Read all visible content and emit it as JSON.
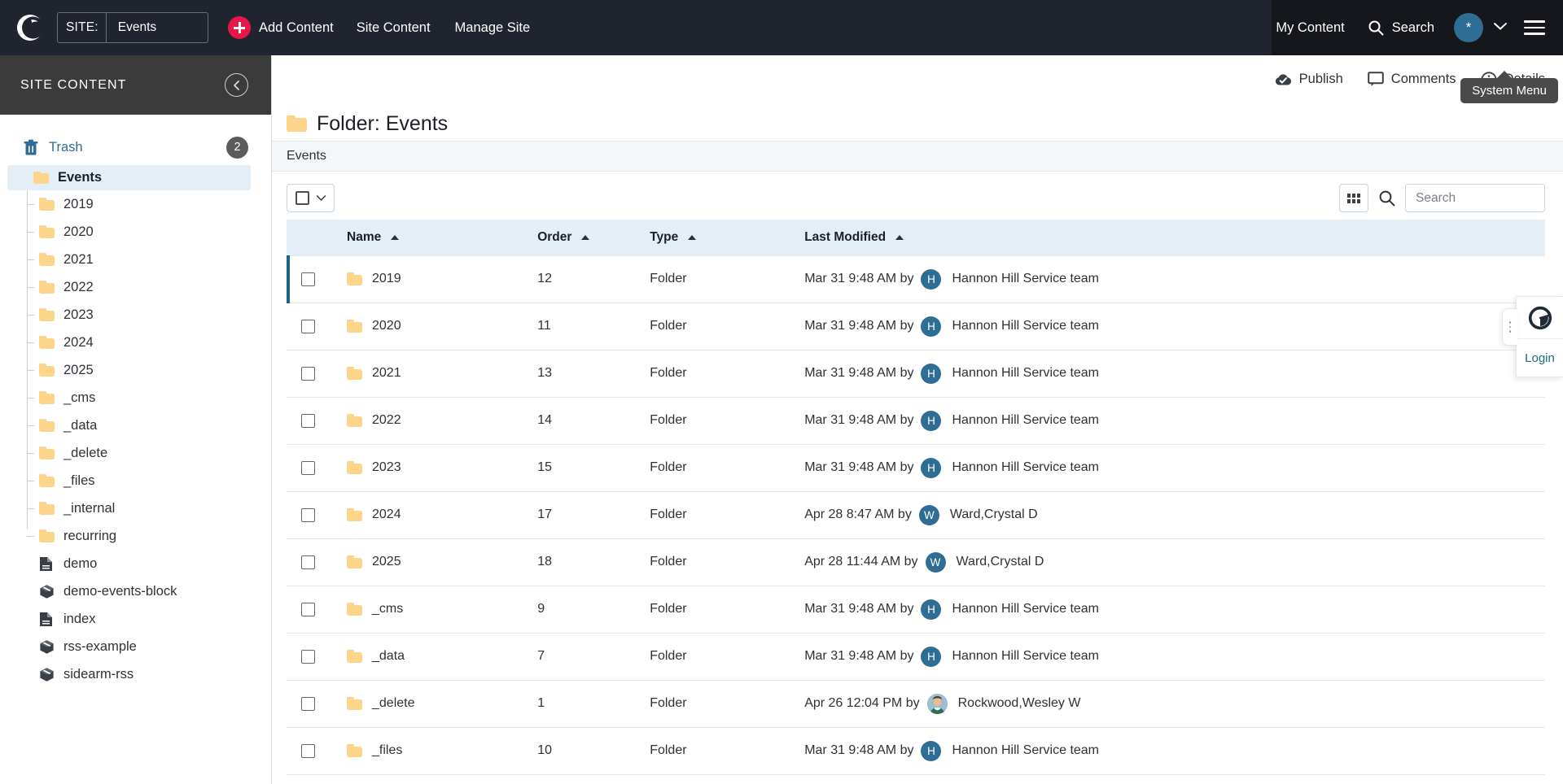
{
  "topbar": {
    "logo_icon": "cascade-logo-icon",
    "site_label": "SITE:",
    "site_value": "Events",
    "add_content": "Add Content",
    "nav": [
      {
        "label": "Site Content"
      },
      {
        "label": "Manage Site"
      }
    ],
    "my_content": "My Content",
    "search": "Search",
    "avatar_initial": "*"
  },
  "sidebar": {
    "header_title": "SITE CONTENT",
    "collapse_icon": "chevron-left-icon",
    "trash": {
      "label": "Trash",
      "count": "2",
      "icon": "trash-icon"
    },
    "root": {
      "label": "Events",
      "icon": "folder-icon"
    },
    "items": [
      {
        "label": "2019",
        "icon": "folder-icon"
      },
      {
        "label": "2020",
        "icon": "folder-icon"
      },
      {
        "label": "2021",
        "icon": "folder-icon"
      },
      {
        "label": "2022",
        "icon": "folder-icon"
      },
      {
        "label": "2023",
        "icon": "folder-icon"
      },
      {
        "label": "2024",
        "icon": "folder-icon"
      },
      {
        "label": "2025",
        "icon": "folder-icon"
      },
      {
        "label": "_cms",
        "icon": "folder-icon"
      },
      {
        "label": "_data",
        "icon": "folder-icon"
      },
      {
        "label": "_delete",
        "icon": "folder-icon"
      },
      {
        "label": "_files",
        "icon": "folder-icon"
      },
      {
        "label": "_internal",
        "icon": "folder-icon"
      },
      {
        "label": "recurring",
        "icon": "folder-icon"
      },
      {
        "label": "demo",
        "icon": "page-icon"
      },
      {
        "label": "demo-events-block",
        "icon": "block-icon"
      },
      {
        "label": "index",
        "icon": "page-icon"
      },
      {
        "label": "rss-example",
        "icon": "block-icon"
      },
      {
        "label": "sidearm-rss",
        "icon": "block-icon"
      }
    ]
  },
  "main": {
    "toolbar": [
      {
        "label": "Publish",
        "icon": "publish-cloud-check-icon"
      },
      {
        "label": "Comments",
        "icon": "comment-icon"
      },
      {
        "label": "Details",
        "icon": "info-circle-icon"
      }
    ],
    "tooltip": "System Menu",
    "page_title": "Folder: Events",
    "breadcrumb": "Events",
    "search_placeholder": "Search",
    "search_value": "",
    "grid_toggle_icon": "grid-view-icon",
    "search_icon": "search-icon",
    "columns": [
      {
        "label": "Name",
        "sort": "asc"
      },
      {
        "label": "Order",
        "sort": "asc"
      },
      {
        "label": "Type",
        "sort": "asc"
      },
      {
        "label": "Last Modified",
        "sort": "asc"
      }
    ],
    "rows": [
      {
        "name": "2019",
        "icon": "folder-icon",
        "order": "12",
        "type": "Folder",
        "modified": "Mar 31 9:48 AM by",
        "avatar": "H",
        "avatar_kind": "initial",
        "user": "Hannon Hill Service team"
      },
      {
        "name": "2020",
        "icon": "folder-icon",
        "order": "11",
        "type": "Folder",
        "modified": "Mar 31 9:48 AM by",
        "avatar": "H",
        "avatar_kind": "initial",
        "user": "Hannon Hill Service team"
      },
      {
        "name": "2021",
        "icon": "folder-icon",
        "order": "13",
        "type": "Folder",
        "modified": "Mar 31 9:48 AM by",
        "avatar": "H",
        "avatar_kind": "initial",
        "user": "Hannon Hill Service team"
      },
      {
        "name": "2022",
        "icon": "folder-icon",
        "order": "14",
        "type": "Folder",
        "modified": "Mar 31 9:48 AM by",
        "avatar": "H",
        "avatar_kind": "initial",
        "user": "Hannon Hill Service team"
      },
      {
        "name": "2023",
        "icon": "folder-icon",
        "order": "15",
        "type": "Folder",
        "modified": "Mar 31 9:48 AM by",
        "avatar": "H",
        "avatar_kind": "initial",
        "user": "Hannon Hill Service team"
      },
      {
        "name": "2024",
        "icon": "folder-icon",
        "order": "17",
        "type": "Folder",
        "modified": "Apr 28 8:47 AM by",
        "avatar": "W",
        "avatar_kind": "initial",
        "user": "Ward,Crystal D"
      },
      {
        "name": "2025",
        "icon": "folder-icon",
        "order": "18",
        "type": "Folder",
        "modified": "Apr 28 11:44 AM by",
        "avatar": "W",
        "avatar_kind": "initial",
        "user": "Ward,Crystal D"
      },
      {
        "name": "_cms",
        "icon": "folder-icon",
        "order": "9",
        "type": "Folder",
        "modified": "Mar 31 9:48 AM by",
        "avatar": "H",
        "avatar_kind": "initial",
        "user": "Hannon Hill Service team"
      },
      {
        "name": "_data",
        "icon": "folder-icon",
        "order": "7",
        "type": "Folder",
        "modified": "Mar 31 9:48 AM by",
        "avatar": "H",
        "avatar_kind": "initial",
        "user": "Hannon Hill Service team"
      },
      {
        "name": "_delete",
        "icon": "folder-icon",
        "order": "1",
        "type": "Folder",
        "modified": "Apr 26 12:04 PM by",
        "avatar": "",
        "avatar_kind": "photo",
        "user": "Rockwood,Wesley W"
      },
      {
        "name": "_files",
        "icon": "folder-icon",
        "order": "10",
        "type": "Folder",
        "modified": "Mar 31 9:48 AM by",
        "avatar": "H",
        "avatar_kind": "initial",
        "user": "Hannon Hill Service team"
      }
    ]
  },
  "extension": {
    "icon": "password-manager-icon",
    "login_label": "Login",
    "drag_handle_icon": "drag-handle-icon"
  },
  "colors": {
    "topbar_bg": "#20242e",
    "topbar_right_bg": "#15171d",
    "accent_pink": "#e8174a",
    "folder_yellow": "#fcd58a",
    "link_blue": "#2f6e94",
    "table_header_bg": "#e4eef7",
    "row_indicator": "#1a6585",
    "sidebar_header_bg": "#3b3b3b"
  }
}
